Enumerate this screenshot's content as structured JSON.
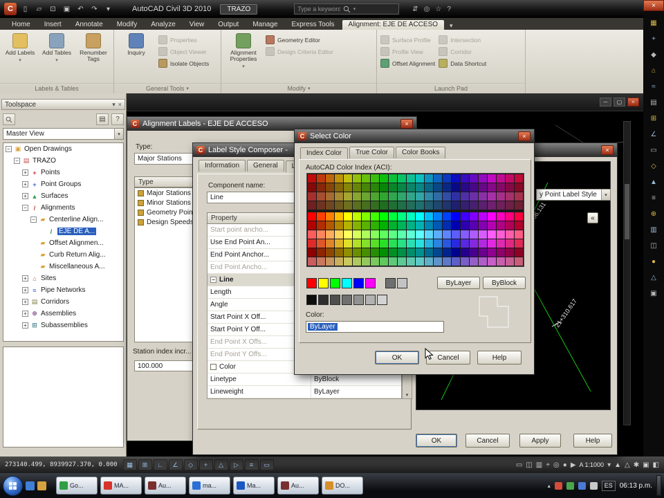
{
  "titlebar": {
    "app_title": "AutoCAD Civil 3D 2010",
    "doc_badge": "TRAZO",
    "search_placeholder": "Type a keyword or phrase"
  },
  "ribbon": {
    "tabs": [
      {
        "label": "Home"
      },
      {
        "label": "Insert"
      },
      {
        "label": "Annotate"
      },
      {
        "label": "Modify"
      },
      {
        "label": "Analyze"
      },
      {
        "label": "View"
      },
      {
        "label": "Output"
      },
      {
        "label": "Manage"
      },
      {
        "label": "Express Tools"
      },
      {
        "label": "Alignment: EJE DE ACCESO",
        "active": true
      }
    ],
    "panels": [
      {
        "title": "Labels & Tables",
        "caret": false,
        "items": [
          {
            "label": "Add Labels",
            "icon": "add-labels",
            "caret": true
          },
          {
            "label": "Add Tables",
            "icon": "add-tables",
            "caret": true
          },
          {
            "label": "Renumber Tags",
            "icon": "renumber-tags"
          }
        ]
      },
      {
        "title": "General Tools",
        "caret": true,
        "items": [
          {
            "label": "Inquiry",
            "icon": "inquiry"
          },
          {
            "label": "Properties",
            "icon": "properties",
            "disabled": true
          },
          {
            "label": "Object Viewer",
            "icon": "object-viewer",
            "disabled": true
          },
          {
            "label": "Isolate Objects",
            "icon": "isolate-objects"
          }
        ]
      },
      {
        "title": "Modify",
        "caret": true,
        "items": [
          {
            "label": "Alignment Properties",
            "icon": "alignment-properties",
            "caret": true
          },
          {
            "label": "Geometry Editor",
            "icon": "geometry-editor"
          },
          {
            "label": "Design Criteria Editor",
            "icon": "design-criteria-editor",
            "disabled": true
          }
        ]
      },
      {
        "title": "Launch Pad",
        "caret": false,
        "items": [
          {
            "label": "Surface Profile",
            "icon": "surface-profile",
            "disabled": true
          },
          {
            "label": "Profile View",
            "icon": "profile-view",
            "disabled": true
          },
          {
            "label": "Offset Alignment",
            "icon": "offset-alignment"
          },
          {
            "label": "Intersection",
            "icon": "intersection",
            "disabled": true
          },
          {
            "label": "Corridor",
            "icon": "corridor",
            "disabled": true
          },
          {
            "label": "Data Shortcut",
            "icon": "data-shortcut"
          }
        ]
      }
    ]
  },
  "toolspace": {
    "title": "Toolspace",
    "view_selector": "Master View",
    "tree": [
      {
        "label": "Open Drawings",
        "depth": 0,
        "icon": "open-drawings",
        "exp": "minus"
      },
      {
        "label": "TRAZO",
        "depth": 1,
        "icon": "drawing",
        "exp": "minus"
      },
      {
        "label": "Points",
        "depth": 2,
        "icon": "points",
        "exp": "plus"
      },
      {
        "label": "Point Groups",
        "depth": 2,
        "icon": "point-groups",
        "exp": "plus"
      },
      {
        "label": "Surfaces",
        "depth": 2,
        "icon": "surfaces",
        "exp": "plus"
      },
      {
        "label": "Alignments",
        "depth": 2,
        "icon": "alignments",
        "exp": "minus"
      },
      {
        "label": "Centerline Align...",
        "depth": 3,
        "icon": "folder",
        "exp": "minus"
      },
      {
        "label": "EJE DE A...",
        "depth": 4,
        "icon": "alignment",
        "selected": true
      },
      {
        "label": "Offset Alignmen...",
        "depth": 3,
        "icon": "folder"
      },
      {
        "label": "Curb Return Alig...",
        "depth": 3,
        "icon": "folder"
      },
      {
        "label": "Miscellaneous A...",
        "depth": 3,
        "icon": "folder"
      },
      {
        "label": "Sites",
        "depth": 2,
        "icon": "sites",
        "exp": "plus"
      },
      {
        "label": "Pipe Networks",
        "depth": 2,
        "icon": "pipe-networks",
        "exp": "plus"
      },
      {
        "label": "Corridors",
        "depth": 2,
        "icon": "corridors",
        "exp": "plus"
      },
      {
        "label": "Assemblies",
        "depth": 2,
        "icon": "assemblies",
        "exp": "plus"
      },
      {
        "label": "Subassemblies",
        "depth": 2,
        "icon": "subassemblies",
        "exp": "plus"
      }
    ]
  },
  "alignment_labels_dialog": {
    "title": "Alignment Labels - EJE DE ACCESO",
    "type_label": "Type:",
    "type_value": "Major Stations",
    "list_header": "Type",
    "list": [
      "Major Stations",
      "Minor Stations",
      "Geometry Points",
      "Design Speeds"
    ],
    "station_index_label": "Station index incr...",
    "station_index_value": "100.000"
  },
  "label_style_composer": {
    "title": "Label Style Composer -",
    "tabs": [
      {
        "label": "Information"
      },
      {
        "label": "General"
      },
      {
        "label": "Layout",
        "active": true
      }
    ],
    "component_name_label": "Component name:",
    "component_name_value": "Line",
    "grid_header": "Property",
    "properties": [
      {
        "name": "Start point ancho...",
        "disabled": true
      },
      {
        "name": "Use End Point An..."
      },
      {
        "name": "End Point Anchor..."
      },
      {
        "name": "End Point Ancho...",
        "disabled": true
      },
      {
        "name": "Line",
        "group": true
      },
      {
        "name": "Length"
      },
      {
        "name": "Angle"
      },
      {
        "name": "Start Point X Off..."
      },
      {
        "name": "Start Point Y Off..."
      },
      {
        "name": "End Point X Offs...",
        "disabled": true
      },
      {
        "name": "End Point Y Offs...",
        "disabled": true
      },
      {
        "name": "Color",
        "checkbox": true
      },
      {
        "name": "Linetype",
        "value": "ByBlock"
      },
      {
        "name": "Lineweight",
        "value": "ByLayer"
      }
    ],
    "preview_selector": "y Point Label Style",
    "preview_labels": [
      "21+306.131",
      "21+310.617"
    ],
    "buttons": {
      "ok": "OK",
      "cancel": "Cancel",
      "apply": "Apply",
      "help": "Help"
    }
  },
  "select_color_dialog": {
    "title": "Select Color",
    "tabs": [
      {
        "label": "Index Color",
        "active": true
      },
      {
        "label": "True Color"
      },
      {
        "label": "Color Books"
      }
    ],
    "aci_label": "AutoCAD Color Index (ACI):",
    "bylayer_button": "ByLayer",
    "byblock_button": "ByBlock",
    "color_label": "Color:",
    "color_value": "ByLayer",
    "buttons": {
      "ok": "OK",
      "cancel": "Cancel",
      "help": "Help"
    },
    "standard_colors": [
      "#ff0000",
      "#ffff00",
      "#00ff00",
      "#00ffff",
      "#0000ff",
      "#ff00ff"
    ],
    "small_grays": [
      "#6e6e6e",
      "#c3c3c3"
    ],
    "gray_row": [
      "#0d0d0d",
      "#2e2e2e",
      "#4f4f4f",
      "#707070",
      "#919191",
      "#b2b2b2",
      "#d3d3d3"
    ],
    "palette": {
      "columns": 24,
      "hue_step": 15,
      "gap_after_row": 3,
      "rows": [
        {
          "s": 88,
          "l": 40
        },
        {
          "s": 88,
          "l": 28
        },
        {
          "s": 55,
          "l": 42
        },
        {
          "s": 55,
          "l": 28
        },
        {
          "s": 100,
          "l": 50
        },
        {
          "s": 100,
          "l": 35
        },
        {
          "s": 100,
          "l": 68
        },
        {
          "s": 75,
          "l": 52
        },
        {
          "s": 100,
          "l": 28
        },
        {
          "s": 50,
          "l": 58
        }
      ]
    }
  },
  "statusbar": {
    "coordinates": "273140.499, 8939927.370, 0.000",
    "scale": "A 1:1000"
  },
  "taskbar": {
    "items": [
      {
        "label": "Go...",
        "color": "#2f9e44"
      },
      {
        "label": "MA...",
        "color": "#d6332b"
      },
      {
        "label": "Au...",
        "color": "#7a2f2f"
      },
      {
        "label": "ma...",
        "color": "#2b6fd6"
      },
      {
        "label": "Ma...",
        "color": "#1a57c2"
      },
      {
        "label": "Au...",
        "color": "#7a2f2f"
      },
      {
        "label": "DO...",
        "color": "#d68f2b"
      }
    ],
    "tray_lang": "ES",
    "clock": "06:13 p.m."
  }
}
